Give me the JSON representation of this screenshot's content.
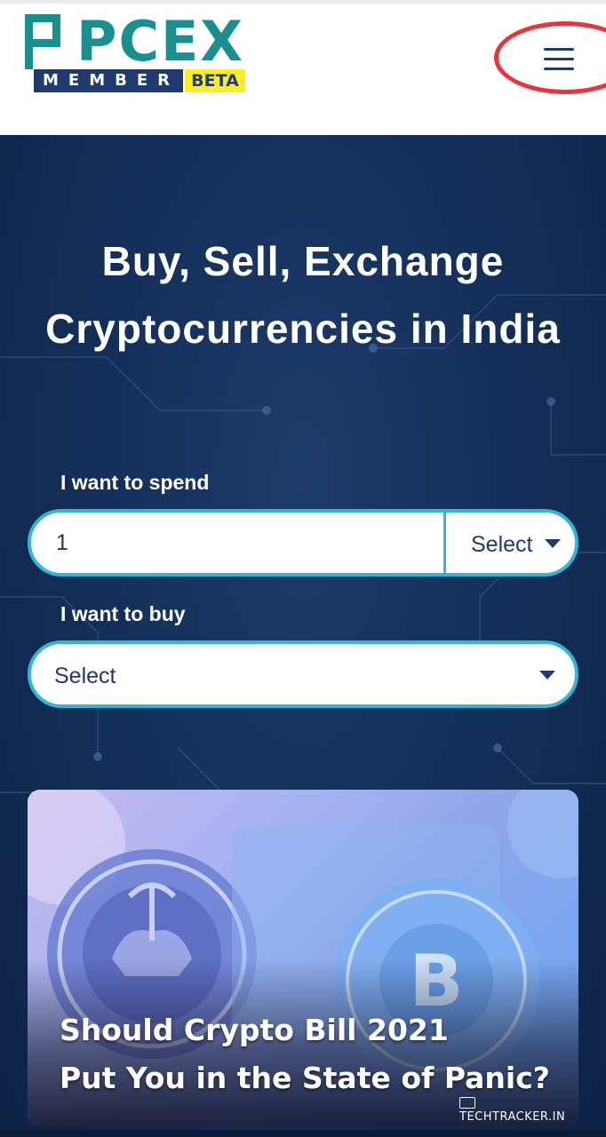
{
  "brand": {
    "logo_text": "PCEX",
    "member_text": "MEMBER",
    "badge_text": "BETA"
  },
  "nav": {
    "menu_icon": "hamburger-menu-icon",
    "menu_highlight_color": "#e8343a"
  },
  "hero": {
    "headline": "Buy, Sell, Exchange Cryptocurrencies in India"
  },
  "form": {
    "spend_label": "I want to spend",
    "spend_value": "1",
    "spend_currency_selected": "Select",
    "buy_label": "I want to buy",
    "buy_selected": "Select"
  },
  "article": {
    "title_line1": "Should Crypto Bill 2021",
    "title_line2": "Put You in the State of Panic?",
    "watermark": "TECHTRACKER.IN"
  },
  "colors": {
    "brand_navy": "#1e3a6e",
    "brand_teal": "#1a8f8f",
    "input_border": "#33b5d8",
    "badge_yellow": "#ffee22",
    "hero_background": "#14305a"
  }
}
